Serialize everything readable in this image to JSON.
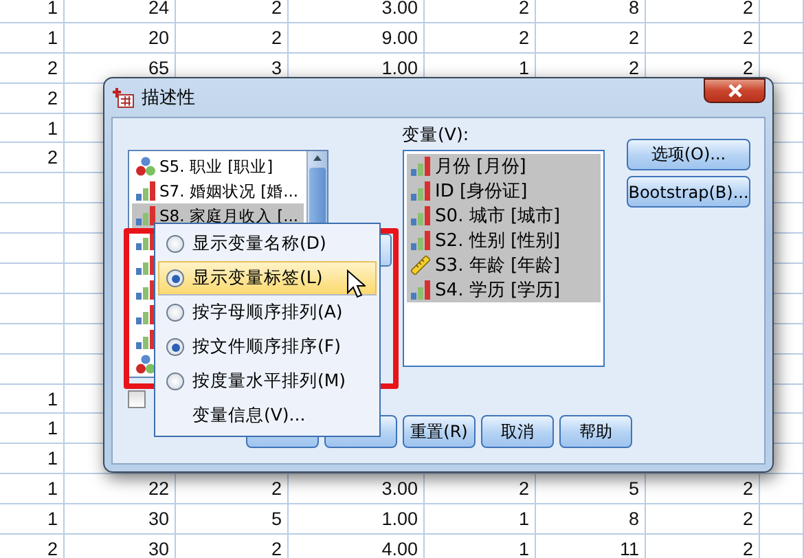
{
  "spreadsheet": {
    "top_rows": [
      {
        "cells": [
          "1",
          "24",
          "2",
          "3.00",
          "2",
          "8",
          "2"
        ]
      },
      {
        "cells": [
          "1",
          "20",
          "2",
          "9.00",
          "2",
          "2",
          "2"
        ]
      },
      {
        "cells": [
          "2",
          "65",
          "3",
          "1.00",
          "1",
          "2",
          "2"
        ]
      },
      {
        "cells": [
          "2"
        ]
      },
      {
        "cells": [
          "1"
        ]
      },
      {
        "cells": [
          "2"
        ]
      }
    ],
    "bottom_rows": [
      {
        "cells": [
          "1"
        ]
      },
      {
        "cells": [
          "1"
        ]
      },
      {
        "cells": [
          "1"
        ]
      },
      {
        "cells": [
          "1",
          "22",
          "2",
          "3.00",
          "2",
          "5",
          "2"
        ]
      },
      {
        "cells": [
          "1",
          "30",
          "5",
          "1.00",
          "1",
          "8",
          "2"
        ]
      },
      {
        "cells": [
          "2",
          "30",
          "2",
          "4.00",
          "1",
          "11",
          "2"
        ]
      }
    ]
  },
  "dialog": {
    "title": "描述性",
    "source_list": {
      "items": [
        {
          "kind": "nominal",
          "label": "S5. 职业 [职业]",
          "selected": false
        },
        {
          "kind": "scale",
          "label": "S7. 婚姻状况 [婚...",
          "selected": false
        },
        {
          "kind": "scale",
          "label": "S8. 家庭月收入 [...",
          "selected": true
        },
        {
          "kind": "scale",
          "selected": false
        },
        {
          "kind": "scale",
          "selected": false
        },
        {
          "kind": "scale",
          "selected": false
        },
        {
          "kind": "scale",
          "selected": false
        },
        {
          "kind": "scale",
          "selected": false
        },
        {
          "kind": "nominal",
          "selected": false
        }
      ]
    },
    "checkbox": {
      "checked": false
    },
    "target_label": "变量(V):",
    "target_list": {
      "items": [
        {
          "kind": "scale",
          "label": "月份 [月份]",
          "selected": true
        },
        {
          "kind": "scale",
          "label": "ID [身份证]",
          "selected": true
        },
        {
          "kind": "scale",
          "label": "S0. 城市 [城市]",
          "selected": true
        },
        {
          "kind": "scale",
          "label": "S2. 性别 [性别]",
          "selected": true
        },
        {
          "kind": "ruler",
          "label": "S3. 年龄 [年龄]",
          "selected": true
        },
        {
          "kind": "scale",
          "label": "S4. 学历 [学历]",
          "selected": true
        }
      ]
    },
    "side_buttons": [
      "选项(O)...",
      "Bootstrap(B)..."
    ],
    "bottom_buttons": [
      {
        "kind": "covered"
      },
      {
        "kind": "covered"
      },
      {
        "kind": "text",
        "label": "重置(R)"
      },
      {
        "kind": "text",
        "label": "取消"
      },
      {
        "kind": "text",
        "label": "帮助"
      }
    ]
  },
  "context_menu": {
    "items": [
      {
        "kind": "radio",
        "label": "显示变量名称(D)",
        "checked": false,
        "highlighted": false
      },
      {
        "kind": "radio",
        "label": "显示变量标签(L)",
        "checked": true,
        "highlighted": true
      },
      {
        "kind": "radio",
        "label": "按字母顺序排列(A)",
        "checked": false,
        "highlighted": false
      },
      {
        "kind": "radio",
        "label": "按文件顺序排序(F)",
        "checked": true,
        "highlighted": false
      },
      {
        "kind": "radio",
        "label": "按度量水平排列(M)",
        "checked": false,
        "highlighted": false
      },
      {
        "kind": "plain",
        "label": "变量信息(V)...",
        "highlighted": false
      }
    ]
  }
}
